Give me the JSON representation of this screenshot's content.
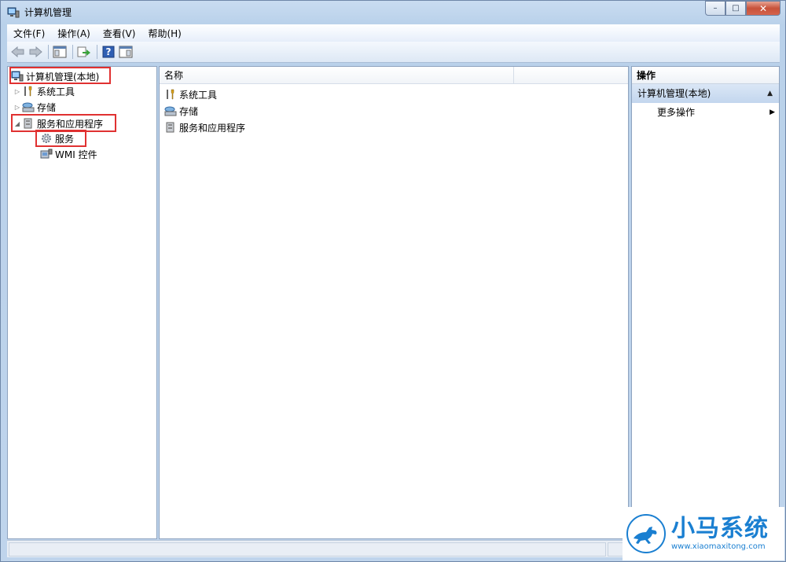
{
  "window": {
    "title": "计算机管理",
    "controls": {
      "minimize": "–",
      "maximize": "□",
      "close": "✕"
    }
  },
  "menu": [
    {
      "label": "文件(F)"
    },
    {
      "label": "操作(A)"
    },
    {
      "label": "查看(V)"
    },
    {
      "label": "帮助(H)"
    }
  ],
  "toolbar": {
    "icons": [
      "back-icon",
      "forward-icon",
      "show-hide-tree-icon",
      "export-list-icon",
      "help-icon",
      "show-hide-action-pane-icon"
    ],
    "help_glyph": "?"
  },
  "tree": {
    "root": "计算机管理(本地)",
    "items": [
      {
        "label": "系统工具",
        "arrow": "▷"
      },
      {
        "label": "存储",
        "arrow": "▷"
      },
      {
        "label": "服务和应用程序",
        "arrow": "◢"
      }
    ],
    "children": [
      {
        "label": "服务"
      },
      {
        "label": "WMI 控件"
      }
    ]
  },
  "list": {
    "column_header": "名称",
    "rows": [
      {
        "label": "系统工具"
      },
      {
        "label": "存储"
      },
      {
        "label": "服务和应用程序"
      }
    ]
  },
  "actions": {
    "header": "操作",
    "section": "计算机管理(本地)",
    "section_arrow": "▲",
    "item": "更多操作",
    "item_arrow": "▶"
  },
  "watermark": {
    "title": "小马系统",
    "url": "www.xiaomaxitong.com"
  },
  "colors": {
    "highlight": "#e03131",
    "section_bg": "#c3d6ee",
    "watermark": "#1a7fd1"
  }
}
